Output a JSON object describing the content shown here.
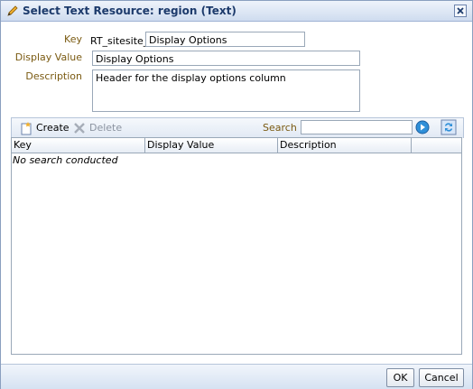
{
  "dialog": {
    "title": "Select Text Resource: region (Text)",
    "icons": {
      "title": "pencil-icon",
      "close": "close-icon"
    }
  },
  "form": {
    "key_label": "Key",
    "key_prefix": "RT_sitesite_",
    "key_value": "Display Options",
    "display_value_label": "Display Value",
    "display_value": "Display Options",
    "description_label": "Description",
    "description_value": "Header for the display options column"
  },
  "toolbar": {
    "create_label": "Create",
    "delete_label": "Delete",
    "search_label": "Search",
    "search_value": "",
    "icons": {
      "create": "create-icon",
      "delete": "delete-icon",
      "go": "go-icon",
      "refresh": "refresh-icon"
    }
  },
  "table": {
    "columns": [
      "Key",
      "Display Value",
      "Description"
    ],
    "empty_message": "No search conducted"
  },
  "footer": {
    "ok_label": "OK",
    "cancel_label": "Cancel"
  },
  "colors": {
    "label": "#7a5a11",
    "title": "#1c3a6b",
    "border": "#9aa8b8"
  }
}
